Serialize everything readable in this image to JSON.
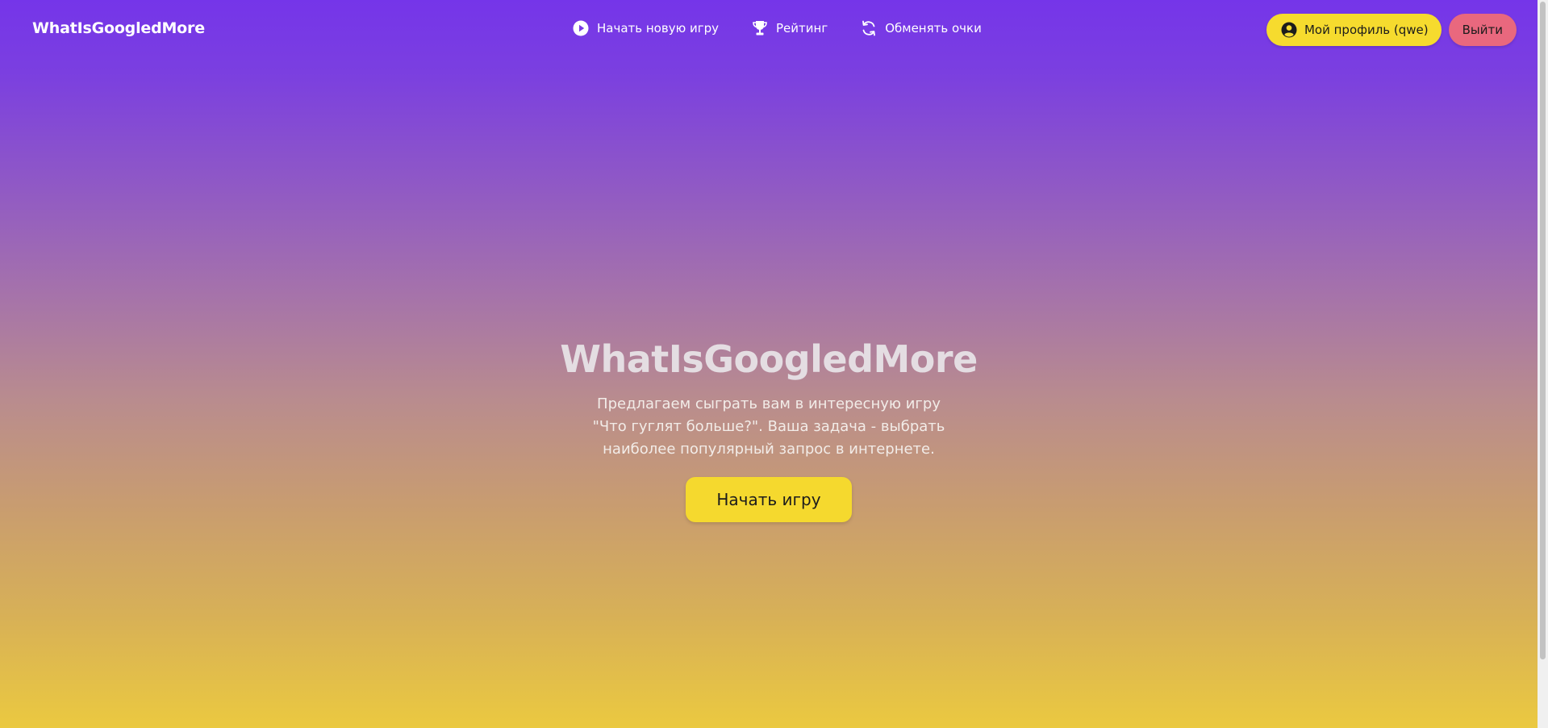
{
  "navbar": {
    "brand": "WhatIsGoogledMore",
    "links": [
      {
        "label": "Начать новую игру",
        "icon": "play-circle-icon"
      },
      {
        "label": "Рейтинг",
        "icon": "trophy-icon"
      },
      {
        "label": "Обменять очки",
        "icon": "refresh-icon"
      }
    ],
    "profile_button": {
      "label": "Мой профиль (qwe)",
      "icon": "user-circle-icon"
    },
    "logout_button": {
      "label": "Выйти"
    }
  },
  "hero": {
    "title": "WhatIsGoogledMore",
    "description": "Предлагаем сыграть вам в интересную игру \"Что гуглят больше?\". Ваша задача - выбрать наиболее популярный запрос в интернете.",
    "button_label": "Начать игру"
  },
  "colors": {
    "gradient_top": "#7535e9",
    "gradient_bottom": "#ebc940",
    "accent_yellow": "#f6db2e",
    "logout_pink": "#e9687e"
  }
}
